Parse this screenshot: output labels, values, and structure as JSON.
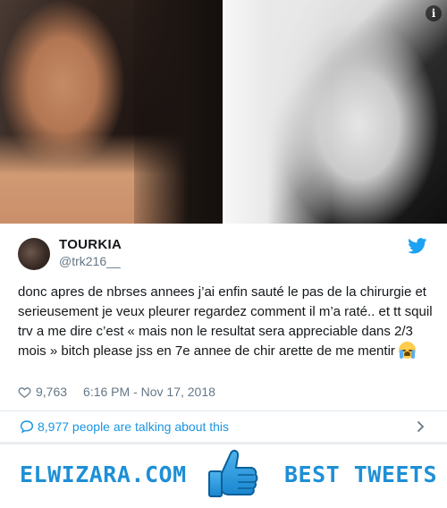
{
  "media": {
    "info_glyph": "i",
    "icon": "info-icon"
  },
  "author": {
    "display_name": "TOURKIA",
    "screen_name": "@trk216__"
  },
  "tweet": {
    "text": "donc apres de nbrses annees j’ai enfin sauté le pas de la chirurgie et serieusement je veux pleurer regardez comment il m’a raté.. et tt squil trv a me dire c’est « mais non le resultat sera appreciable dans 2/3 mois » bitch please jss en 7e annee de chir arette de me mentir",
    "emoji": "loudly-crying-face-icon"
  },
  "meta": {
    "likes": "9,763",
    "timestamp": "6:16 PM - Nov 17, 2018"
  },
  "conversation": {
    "label": "8,977 people are talking about this"
  },
  "banner": {
    "left": "ELWIZARA.COM",
    "right": "BEST TWEETS"
  },
  "colors": {
    "twitter_blue": "#1da1f2",
    "link_blue": "#1b95e0",
    "banner_blue": "#1e8fd6",
    "muted_text": "#657786"
  }
}
